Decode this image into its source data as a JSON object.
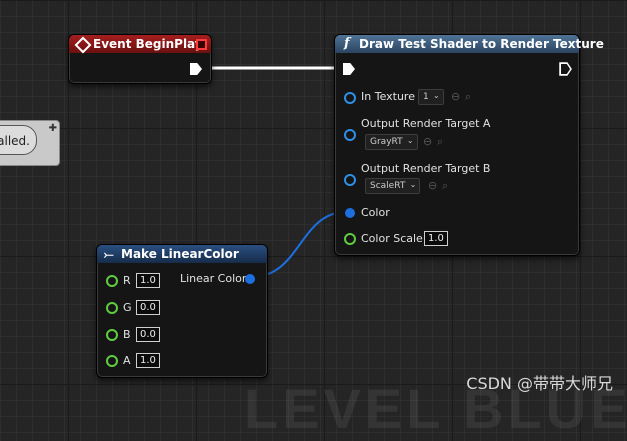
{
  "canvas": {
    "watermark": "LEVEL BLUEPRINT",
    "credit": "CSDN @带带大师兄"
  },
  "comment_node": {
    "visible_text": "alled."
  },
  "event_node": {
    "title": "Event BeginPlay",
    "header_color": "#8c1818"
  },
  "function_node": {
    "icon": "f",
    "title": "Draw Test Shader to Render Texture",
    "header_color": "#3d5c7a",
    "in_texture": {
      "label": "In Texture",
      "value": "1"
    },
    "output_a": {
      "label": "Output Render Target A",
      "value": "GrayRT"
    },
    "output_b": {
      "label": "Output Render Target B",
      "value": "ScaleRT"
    },
    "color": {
      "label": "Color"
    },
    "color_scale": {
      "label": "Color Scale",
      "value": "1.0"
    }
  },
  "make_color_node": {
    "title": "Make LinearColor",
    "header_color": "#1f3d63",
    "output_label": "Linear Color",
    "inputs": [
      {
        "label": "R",
        "value": "1.0"
      },
      {
        "label": "G",
        "value": "0.0"
      },
      {
        "label": "B",
        "value": "0.0"
      },
      {
        "label": "A",
        "value": "1.0"
      }
    ]
  }
}
